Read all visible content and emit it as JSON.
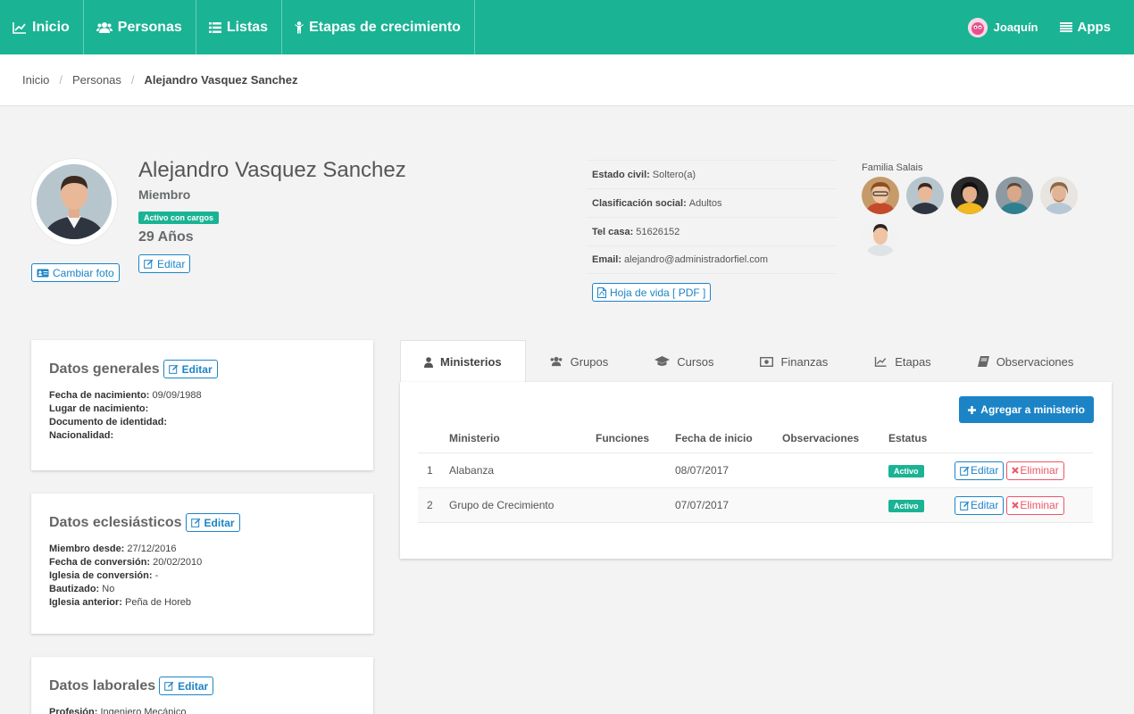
{
  "nav": {
    "items": [
      {
        "label": "Inicio",
        "icon": "chart-line-icon"
      },
      {
        "label": "Personas",
        "icon": "users-icon"
      },
      {
        "label": "Listas",
        "icon": "list-icon"
      },
      {
        "label": "Etapas de crecimiento",
        "icon": "child-icon"
      }
    ],
    "user_name": "Joaquín",
    "apps_label": "Apps"
  },
  "breadcrumb": [
    "Inicio",
    "Personas",
    "Alejandro Vasquez Sanchez"
  ],
  "profile": {
    "name": "Alejandro Vasquez Sanchez",
    "role": "Miembro",
    "status": "Activo con cargos",
    "age": "29 Años",
    "change_photo_label": "Cambiar foto",
    "edit_label": "Editar"
  },
  "contact": {
    "rows": [
      {
        "label": "Estado civil:",
        "value": "Soltero(a)"
      },
      {
        "label": "Clasificación social:",
        "value": "Adultos"
      },
      {
        "label": "Tel casa:",
        "value": "51626152"
      },
      {
        "label": "Email:",
        "value": "alejandro@administradorfiel.com"
      }
    ],
    "cv_label": "Hoja de vida [ PDF ]"
  },
  "family": {
    "title": "Familia Salais"
  },
  "cards": {
    "general": {
      "title": "Datos generales",
      "edit": "Editar",
      "fields": [
        {
          "label": "Fecha de nacimiento:",
          "value": "09/09/1988"
        },
        {
          "label": "Lugar de nacimiento:",
          "value": ""
        },
        {
          "label": "Documento de identidad:",
          "value": ""
        },
        {
          "label": "Nacionalidad:",
          "value": ""
        }
      ]
    },
    "church": {
      "title": "Datos eclesiásticos",
      "edit": "Editar",
      "fields": [
        {
          "label": "Miembro desde:",
          "value": "27/12/2016"
        },
        {
          "label": "Fecha de conversión:",
          "value": "20/02/2010"
        },
        {
          "label": "Iglesia de conversión:",
          "value": "-"
        },
        {
          "label": "Bautizado:",
          "value": "No"
        },
        {
          "label": "Iglesia anterior:",
          "value": "Peña de Horeb"
        }
      ]
    },
    "work": {
      "title": "Datos laborales",
      "edit": "Editar",
      "fields": [
        {
          "label": "Profesión:",
          "value": "Ingeniero Mecánico"
        }
      ]
    }
  },
  "tabs": [
    {
      "label": "Ministerios",
      "icon": "user-icon",
      "active": true
    },
    {
      "label": "Grupos",
      "icon": "users-icon",
      "active": false
    },
    {
      "label": "Cursos",
      "icon": "graduation-cap-icon",
      "active": false
    },
    {
      "label": "Finanzas",
      "icon": "money-icon",
      "active": false
    },
    {
      "label": "Etapas",
      "icon": "chart-line-icon",
      "active": false
    },
    {
      "label": "Observaciones",
      "icon": "book-icon",
      "active": false
    }
  ],
  "ministries": {
    "add_label": "Agregar a ministerio",
    "headers": [
      "",
      "Ministerio",
      "Funciones",
      "Fecha de inicio",
      "Observaciones",
      "Estatus",
      ""
    ],
    "rows": [
      {
        "n": "1",
        "name": "Alabanza",
        "functions": "",
        "start": "08/07/2017",
        "notes": "",
        "status": "Activo"
      },
      {
        "n": "2",
        "name": "Grupo de Crecimiento",
        "functions": "",
        "start": "07/07/2017",
        "notes": "",
        "status": "Activo"
      }
    ],
    "edit_label": "Editar",
    "delete_label": "Eliminar"
  },
  "colors": {
    "brand": "#1ab394",
    "primary": "#1c84c6",
    "danger": "#ed5565"
  }
}
